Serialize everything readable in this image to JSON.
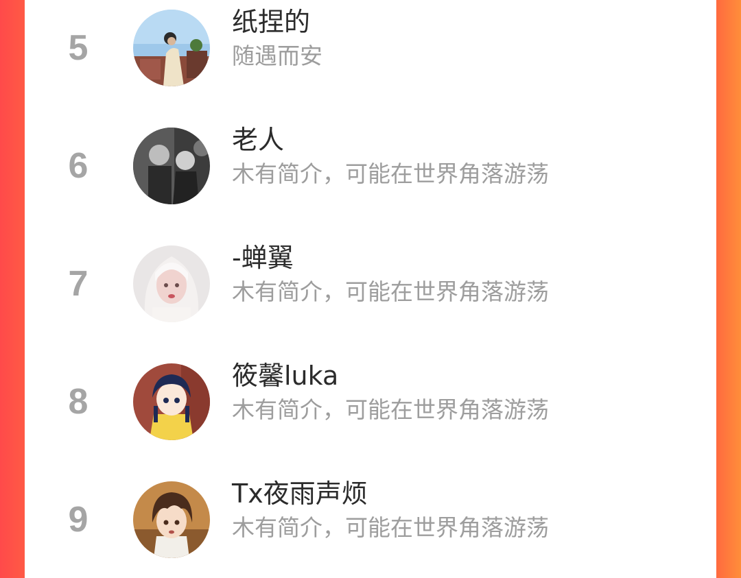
{
  "ranking": {
    "items": [
      {
        "rank": "5",
        "name": "纸捏的",
        "bio": "随遇而安",
        "avatar": "avatar-photo-person-outdoors"
      },
      {
        "rank": "6",
        "name": "老人",
        "bio": "木有简介，可能在世界角落游荡",
        "avatar": "avatar-black-white-couple"
      },
      {
        "rank": "7",
        "name": "-蝉翼",
        "bio": "木有简介，可能在世界角落游荡",
        "avatar": "avatar-white-hair-girl"
      },
      {
        "rank": "8",
        "name": "筱馨luka",
        "bio": "木有简介，可能在世界角落游荡",
        "avatar": "avatar-anime-girl-yellow"
      },
      {
        "rank": "9",
        "name": "Tx夜雨声烦",
        "bio": "木有简介，可能在世界角落游荡",
        "avatar": "avatar-anime-boy-brown-hair"
      }
    ]
  },
  "colors": {
    "background_left": "#ff4a4a",
    "background_right": "#ff8e3a",
    "panel": "#ffffff",
    "rank_text": "#a5a5a5",
    "name_text": "#2b2b2b",
    "bio_text": "#9d9d9d"
  }
}
